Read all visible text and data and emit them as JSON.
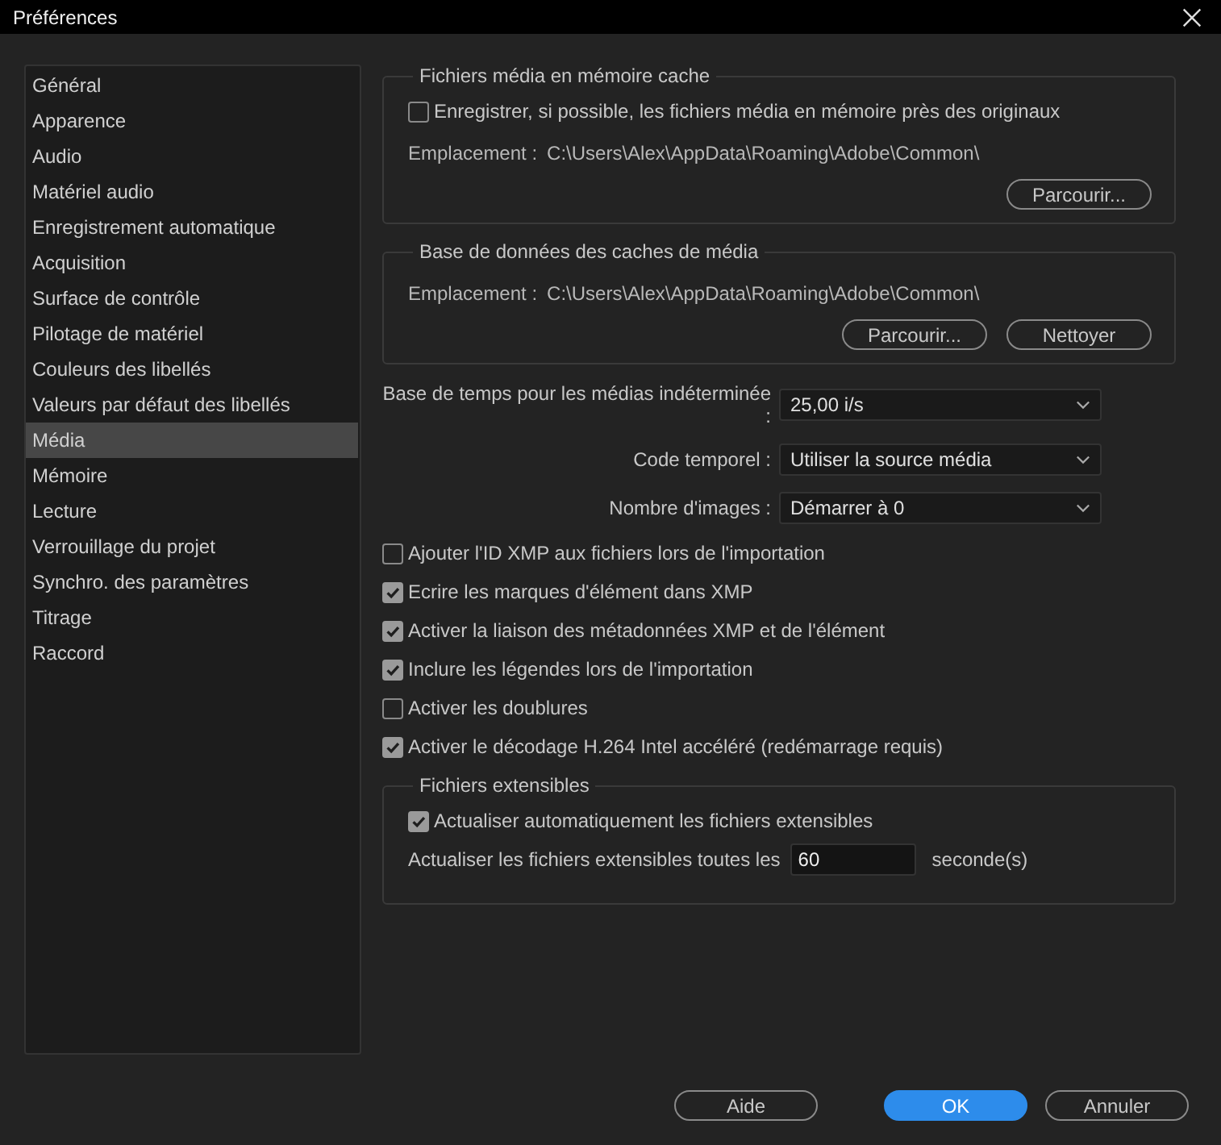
{
  "window": {
    "title": "Préférences"
  },
  "sidebar": {
    "items": [
      {
        "label": "Général",
        "selected": false
      },
      {
        "label": "Apparence",
        "selected": false
      },
      {
        "label": "Audio",
        "selected": false
      },
      {
        "label": "Matériel audio",
        "selected": false
      },
      {
        "label": "Enregistrement automatique",
        "selected": false
      },
      {
        "label": "Acquisition",
        "selected": false
      },
      {
        "label": "Surface de contrôle",
        "selected": false
      },
      {
        "label": "Pilotage de matériel",
        "selected": false
      },
      {
        "label": "Couleurs des libellés",
        "selected": false
      },
      {
        "label": "Valeurs par défaut des libellés",
        "selected": false
      },
      {
        "label": "Média",
        "selected": true
      },
      {
        "label": "Mémoire",
        "selected": false
      },
      {
        "label": "Lecture",
        "selected": false
      },
      {
        "label": "Verrouillage du projet",
        "selected": false
      },
      {
        "label": "Synchro. des paramètres",
        "selected": false
      },
      {
        "label": "Titrage",
        "selected": false
      },
      {
        "label": "Raccord",
        "selected": false
      }
    ]
  },
  "media_cache": {
    "title": "Fichiers média en mémoire cache",
    "checkbox": {
      "label": "Enregistrer, si possible, les fichiers média en mémoire près des originaux",
      "checked": false
    },
    "location_label": "Emplacement :",
    "location": "C:\\Users\\Alex\\AppData\\Roaming\\Adobe\\Common\\",
    "buttons": [
      "Parcourir..."
    ]
  },
  "cache_database": {
    "title": "Base de données des caches de média",
    "location_label": "Emplacement :",
    "location": "C:\\Users\\Alex\\AppData\\Roaming\\Adobe\\Common\\",
    "buttons": [
      "Parcourir...",
      "Nettoyer"
    ]
  },
  "dropdowns": [
    {
      "label": "Base de temps pour les médias indéterminée :",
      "value": "25,00  i/s"
    },
    {
      "label": "Code temporel :",
      "value": "Utiliser la source média"
    },
    {
      "label": "Nombre d'images :",
      "value": "Démarrer à 0"
    }
  ],
  "options": [
    {
      "label": "Ajouter l'ID XMP aux fichiers lors de l'importation",
      "checked": false
    },
    {
      "label": "Ecrire les marques d'élément dans XMP",
      "checked": true
    },
    {
      "label": "Activer la liaison des métadonnées XMP et de l'élément",
      "checked": true
    },
    {
      "label": "Inclure les légendes lors de l'importation",
      "checked": true
    },
    {
      "label": "Activer les doublures",
      "checked": false
    },
    {
      "label": "Activer le décodage H.264 Intel accéléré (redémarrage requis)",
      "checked": true
    }
  ],
  "growing_files": {
    "title": "Fichiers extensibles",
    "checkbox": {
      "label": "Actualiser automatiquement les fichiers extensibles",
      "checked": true
    },
    "interval_label": "Actualiser les fichiers extensibles toutes les",
    "interval_value": "60",
    "interval_unit": "seconde(s)"
  },
  "footer_buttons": [
    {
      "label": "Aide",
      "kind": "normal"
    },
    {
      "label": "OK",
      "kind": "primary"
    },
    {
      "label": "Annuler",
      "kind": "normal"
    }
  ]
}
